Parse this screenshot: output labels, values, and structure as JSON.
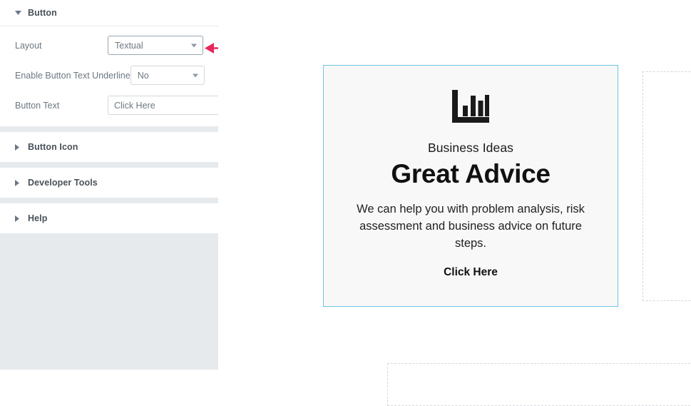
{
  "panel": {
    "open_section": {
      "title": "Button",
      "caret_icon": "caret-down-icon",
      "controls": [
        {
          "label": "Layout",
          "type": "select",
          "value": "Textual",
          "icon": "chevron-down-icon"
        },
        {
          "label": "Enable Button Text Underline",
          "type": "select",
          "value": "No",
          "icon": "chevron-down-icon"
        },
        {
          "label": "Button Text",
          "type": "text",
          "value": "Click Here",
          "placeholder": "Click Here",
          "addon_icon": "dynamic-tags-icon"
        }
      ]
    },
    "collapsed_sections": [
      {
        "title": "Button Icon",
        "caret_icon": "caret-right-icon"
      },
      {
        "title": "Developer Tools",
        "caret_icon": "caret-right-icon"
      },
      {
        "title": "Help",
        "caret_icon": "caret-right-icon"
      }
    ],
    "collapse_handle": {
      "icon": "chevron-left-icon",
      "glyph": "‹"
    },
    "background_color": "#e6eaed",
    "section_background": "#ffffff"
  },
  "annotation": {
    "arrow": {
      "name": "pointer-arrow",
      "direction": "left",
      "color": "#e8265a",
      "points_at": "Layout"
    }
  },
  "preview": {
    "card": {
      "icon": "bar-chart-icon",
      "subtitle": "Business Ideas",
      "title": "Great Advice",
      "description": "We can help you with problem analysis, risk assessment and business advice on future steps.",
      "cta_label": "Click Here",
      "border_color": "#6ec6e4",
      "background_color": "#f8f8f8"
    },
    "placeholders": [
      {
        "name": "right-placeholder",
        "border_color": "#d3d8dd"
      },
      {
        "name": "bottom-placeholder",
        "border_color": "#d3d8dd"
      }
    ]
  }
}
